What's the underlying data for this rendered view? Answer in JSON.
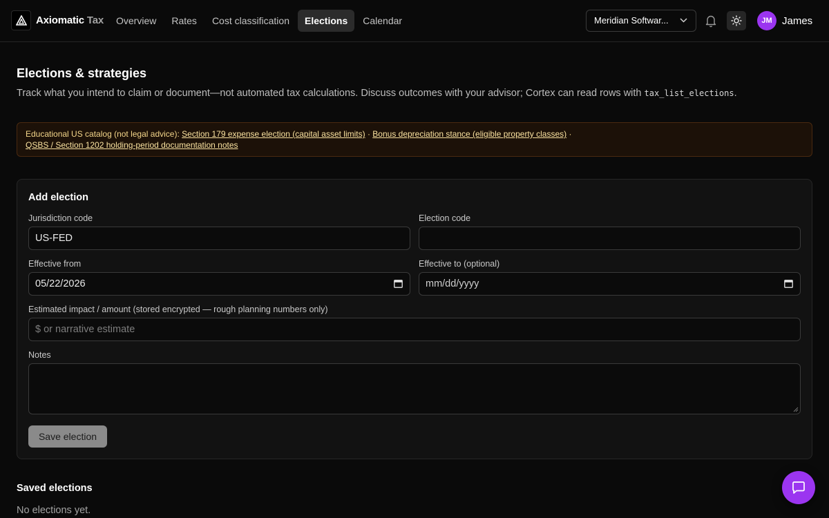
{
  "app": {
    "brand_name": "Axiomatic",
    "brand_suffix": "Tax",
    "logo_icon": "triangle-logo-icon"
  },
  "nav": {
    "items": [
      {
        "label": "Overview",
        "active": false
      },
      {
        "label": "Rates",
        "active": false
      },
      {
        "label": "Cost classification",
        "active": false
      },
      {
        "label": "Elections",
        "active": true
      },
      {
        "label": "Calendar",
        "active": false
      }
    ]
  },
  "header_right": {
    "org_select_value": "Meridian Softwar...",
    "notifications_icon": "bell-icon",
    "theme_icon": "sun-icon",
    "avatar_initials": "JM",
    "user_name": "James"
  },
  "colors": {
    "accent": "#9b35f0",
    "notice_bg": "#1c1108",
    "notice_text": "#f4d68a"
  },
  "page": {
    "title": "Elections & strategies",
    "description_prefix": "Track what you intend to claim or document—not automated tax calculations. Discuss outcomes with your advisor; Cortex can read rows with ",
    "description_code": "tax_list_elections",
    "description_suffix": "."
  },
  "notice": {
    "prefix": "Educational US catalog (not legal advice): ",
    "links": [
      "Section 179 expense election (capital asset limits)",
      "Bonus depreciation stance (eligible property classes)",
      "QSBS / Section 1202 holding-period documentation notes"
    ],
    "separator": " · "
  },
  "form": {
    "title": "Add election",
    "jurisdiction_label": "Jurisdiction code",
    "jurisdiction_value": "US-FED",
    "election_code_label": "Election code",
    "election_code_value": "",
    "effective_from_label": "Effective from",
    "effective_from_value": "05/22/2026",
    "effective_to_label": "Effective to (optional)",
    "effective_to_placeholder": "mm/dd/yyyy",
    "impact_label": "Estimated impact / amount (stored encrypted — rough planning numbers only)",
    "impact_placeholder": "$ or narrative estimate",
    "notes_label": "Notes",
    "save_label": "Save election"
  },
  "saved": {
    "title": "Saved elections",
    "empty_text": "No elections yet."
  },
  "chat": {
    "icon": "chat-bubble-icon"
  }
}
